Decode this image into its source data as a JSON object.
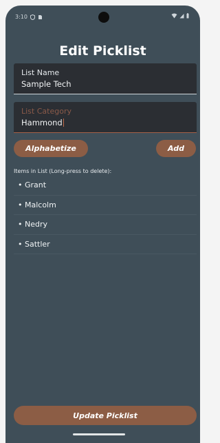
{
  "status_bar": {
    "time": "3:10",
    "icons": [
      "shield-icon",
      "sim-icon",
      "wifi-icon",
      "signal-icon",
      "battery-icon"
    ]
  },
  "screen": {
    "title": "Edit Picklist"
  },
  "form": {
    "list_name": {
      "label": "List Name",
      "value": "Sample Tech"
    },
    "list_category": {
      "label": "List Category",
      "value": "Hammond"
    }
  },
  "actions": {
    "alphabetize_label": "Alphabetize",
    "add_label": "Add",
    "update_label": "Update Picklist"
  },
  "list": {
    "header": "Items in List (Long-press to delete):",
    "items": [
      "• Grant",
      "• Malcolm",
      "• Nedry",
      "• Sattler"
    ]
  },
  "colors": {
    "background": "#3f4e58",
    "accent": "#8c5d45",
    "field_bg": "#2b2e33"
  }
}
